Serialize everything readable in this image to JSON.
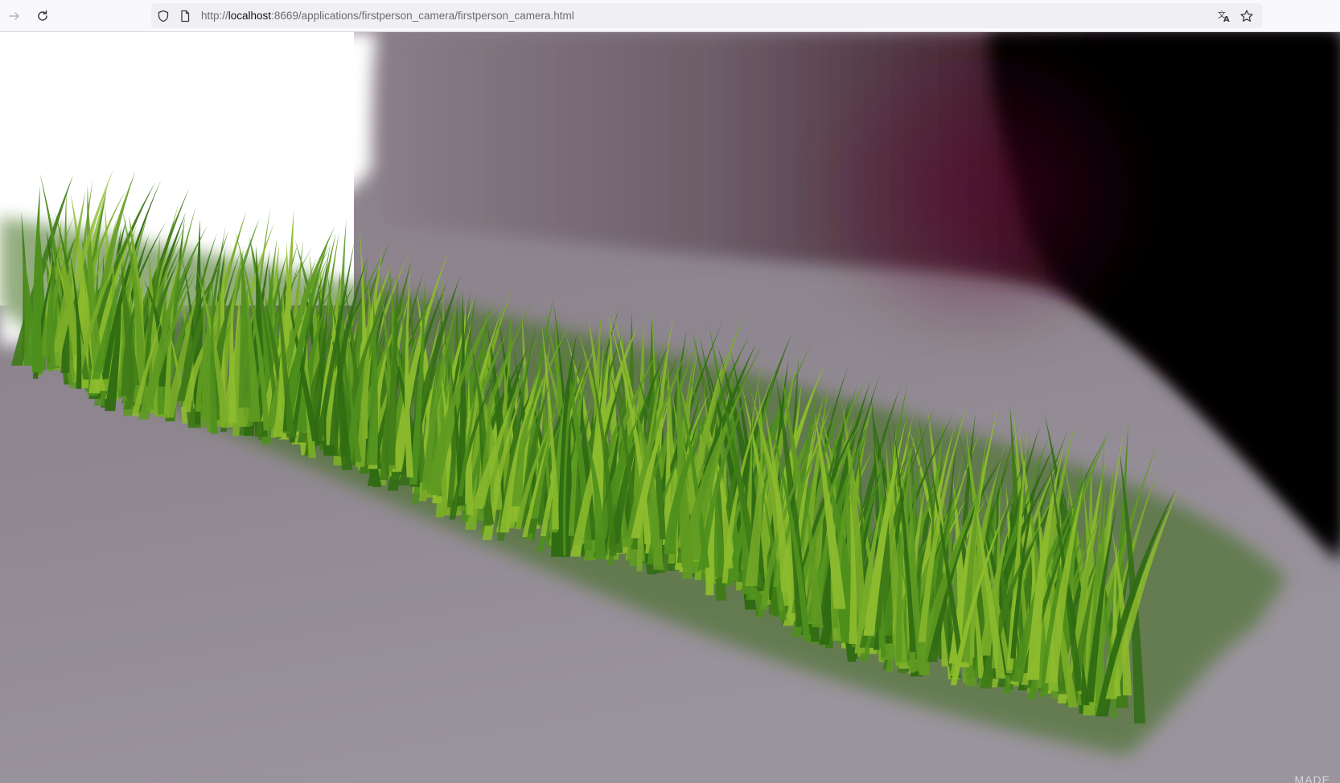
{
  "browser": {
    "back_icon": "arrow-right-icon",
    "reload_icon": "reload-icon",
    "url": {
      "prefix": "http://",
      "host": "localhost",
      "rest": ":8669/applications/firstperson_camera/firstperson_camera.html"
    },
    "site_info_icon": "shield-icon",
    "page_icon": "page-icon",
    "translate_icon": "translate-icon",
    "bookmark_icon": "star-icon"
  },
  "scene": {
    "description_type": "webgl-canvas",
    "colors": {
      "sky": "#ffffff",
      "wall": "#6b5c66",
      "shadow": "#000000",
      "ground": "#948e97",
      "grass_dark": "#2f6b12",
      "grass_mid": "#4e8f1d",
      "grass_light": "#8dbb2e"
    },
    "watermark": "MADE"
  }
}
